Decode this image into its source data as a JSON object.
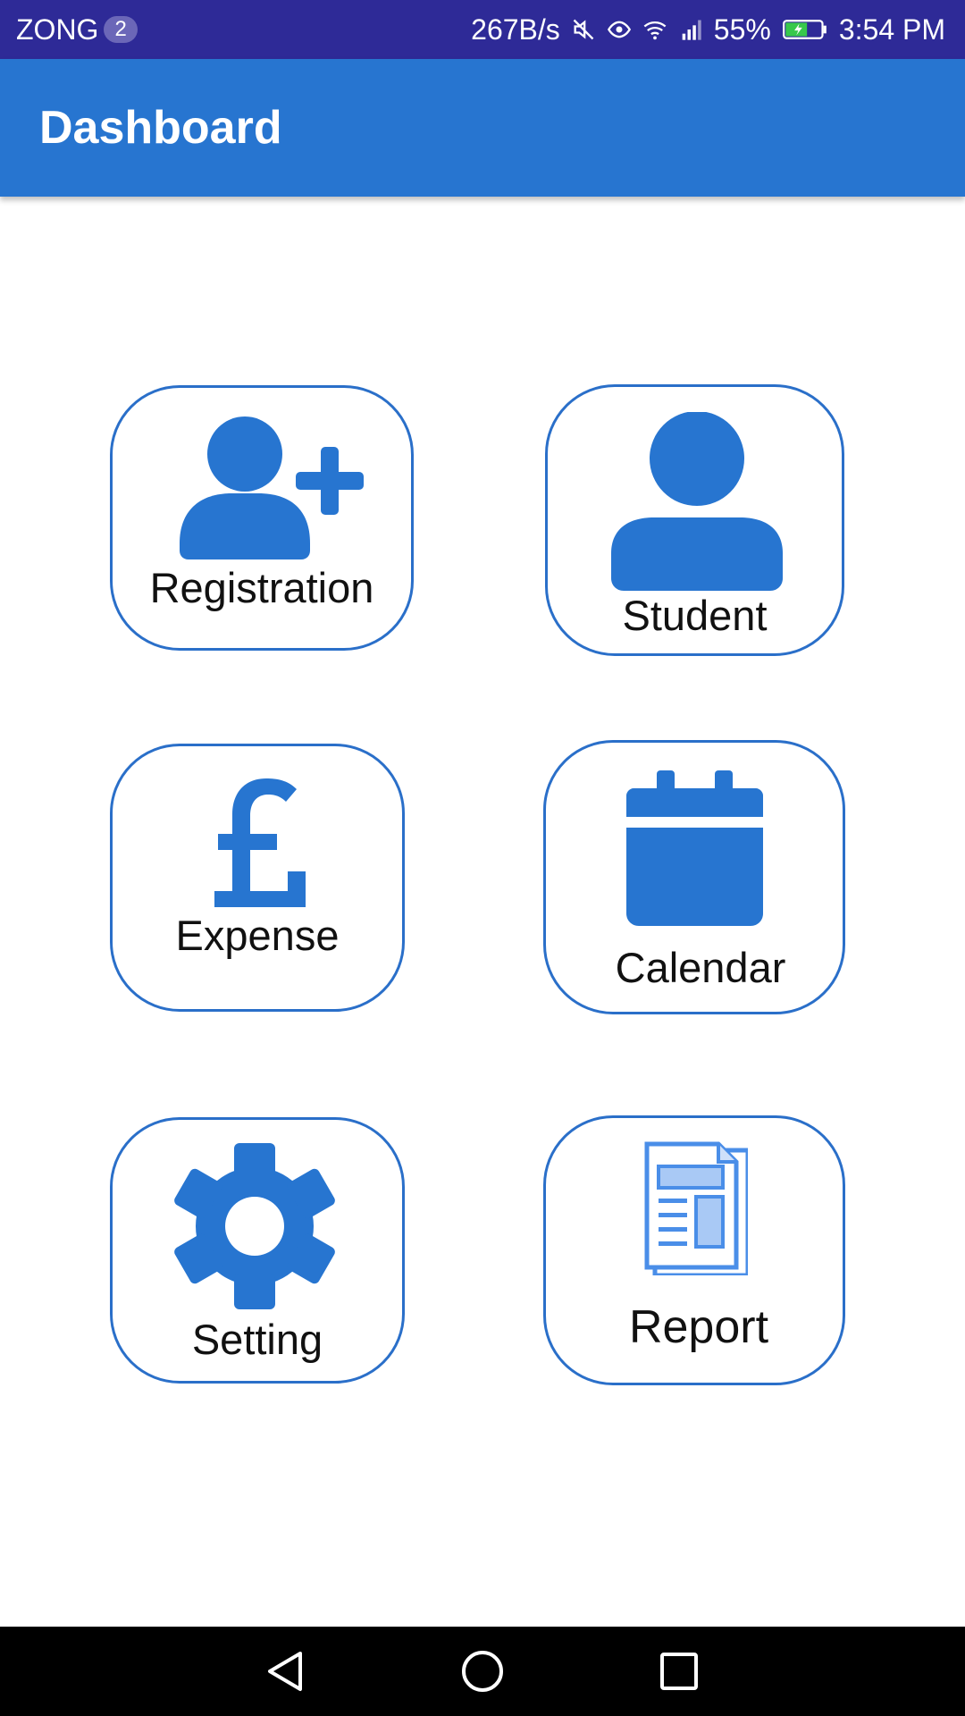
{
  "status_bar": {
    "carrier": "ZONG",
    "sim_slot": "2",
    "net_speed": "267B/s",
    "battery": "55%",
    "time": "3:54 PM",
    "icons": [
      "mute-icon",
      "eye-comfort-icon",
      "wifi-icon",
      "signal-3g-icon",
      "battery-charging-icon"
    ]
  },
  "app_bar": {
    "title": "Dashboard"
  },
  "tiles": [
    {
      "label": "Registration",
      "icon": "add-user-icon"
    },
    {
      "label": "Student",
      "icon": "user-icon"
    },
    {
      "label": "Expense",
      "icon": "pound-icon"
    },
    {
      "label": "Calendar",
      "icon": "calendar-icon"
    },
    {
      "label": "Setting",
      "icon": "gear-icon"
    },
    {
      "label": "Report",
      "icon": "report-icon"
    }
  ],
  "nav_bar": {
    "icons": [
      "back-icon",
      "home-icon",
      "recents-icon"
    ]
  },
  "colors": {
    "status_bar": "#2e2a97",
    "app_bar": "#2775d0",
    "accent": "#2a6fc9",
    "report_icon": "#4a8ee8"
  }
}
